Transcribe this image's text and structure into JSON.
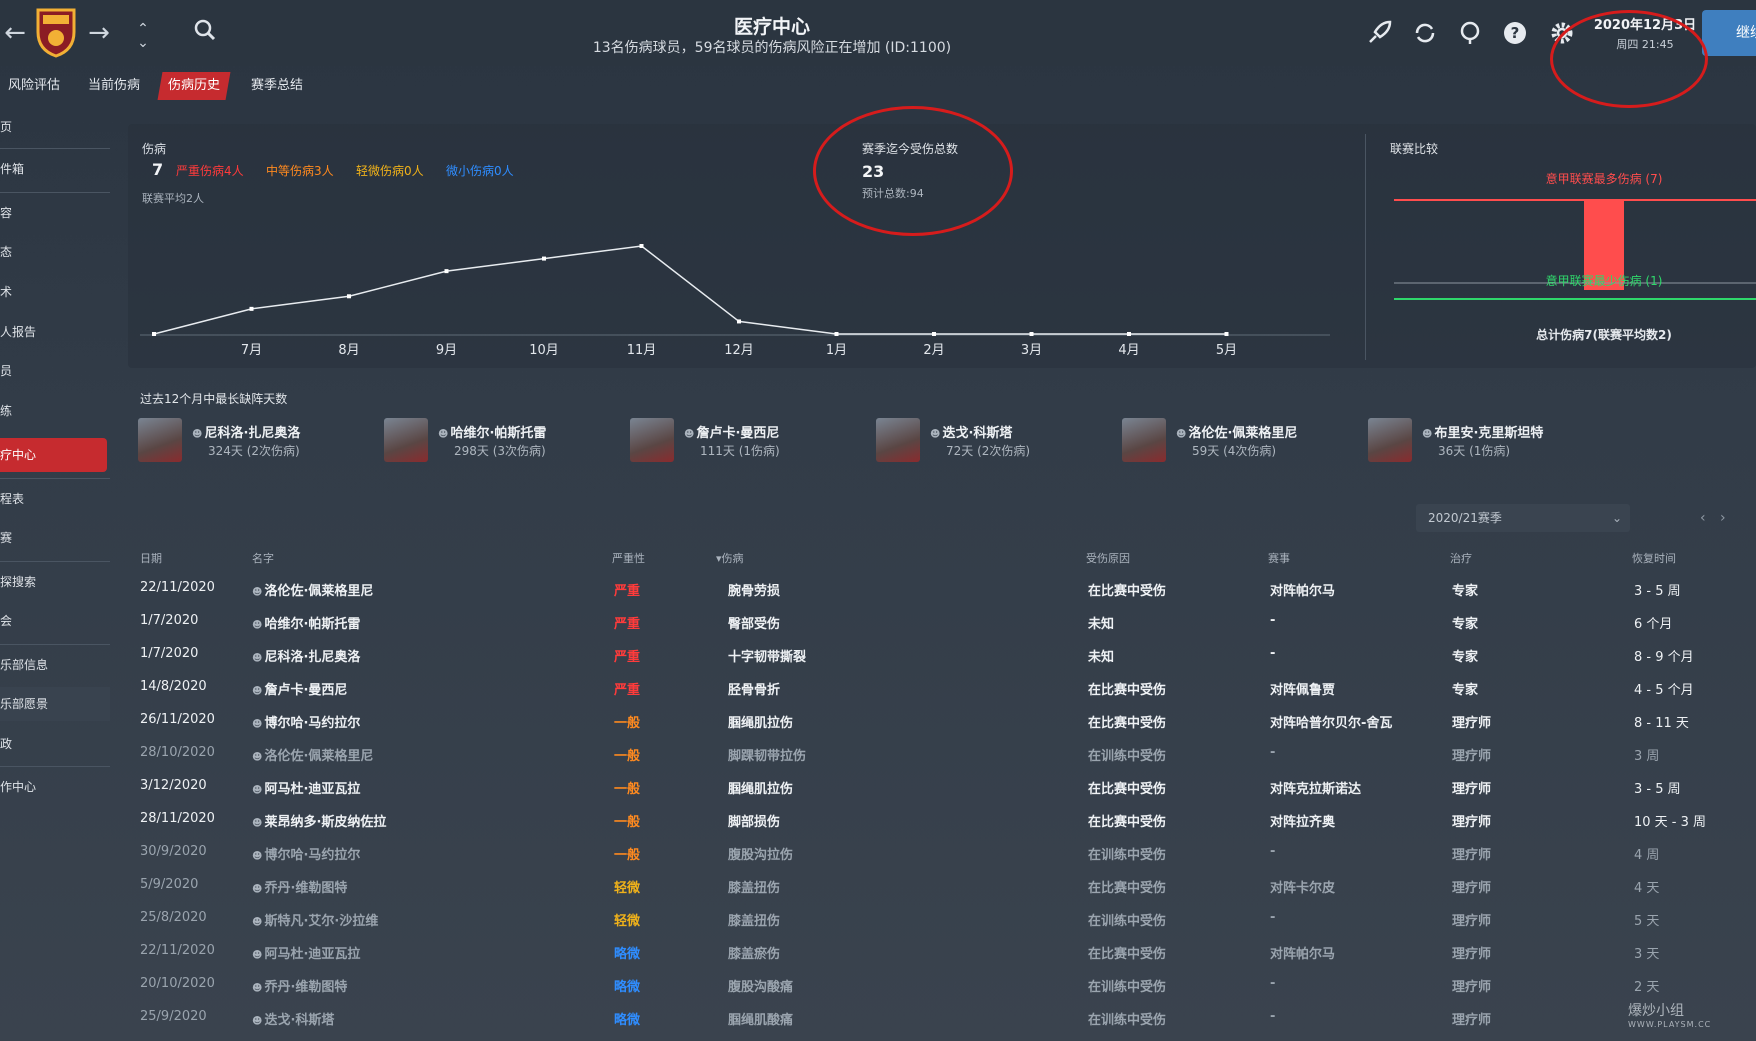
{
  "header": {
    "title": "医疗中心",
    "subtitle": "13名伤病球员，59名球员的伤病风险正在增加 (ID:1100)",
    "date": "2020年12月3日",
    "weekday_time": "周四 21:45",
    "continue_label": "继续"
  },
  "tabs": [
    {
      "label": "风险评估"
    },
    {
      "label": "当前伤病"
    },
    {
      "label": "伤病历史"
    },
    {
      "label": "赛季总结"
    }
  ],
  "sidebar": {
    "items": [
      {
        "label": "页"
      },
      {
        "label": "件箱"
      },
      {
        "label": "容"
      },
      {
        "label": "态"
      },
      {
        "label": "术"
      },
      {
        "label": "人报告"
      },
      {
        "label": "员"
      },
      {
        "label": "练"
      },
      {
        "label": "疗中心"
      },
      {
        "label": "程表"
      },
      {
        "label": "赛"
      },
      {
        "label": "探搜索"
      },
      {
        "label": "会"
      },
      {
        "label": "乐部信息"
      },
      {
        "label": "乐部愿景"
      },
      {
        "label": "政"
      },
      {
        "label": "作中心"
      }
    ]
  },
  "injuries": {
    "label": "伤病",
    "count": "7",
    "serious": "严重伤病4人",
    "medium": "中等伤病3人",
    "light": "轻微伤病0人",
    "minor": "微小伤病0人",
    "league_avg": "联赛平均2人"
  },
  "season_total": {
    "label": "赛季迄今受伤总数",
    "value": "23",
    "projected": "预计总数:94"
  },
  "league_compare": {
    "title": "联赛比较",
    "max_label": "意甲联赛最多伤病 (7)",
    "min_label": "意甲联赛最少伤病 (1)",
    "total_label": "总计伤病7(联赛平均数2)"
  },
  "chart_data": {
    "type": "line",
    "categories": [
      "7月",
      "8月",
      "9月",
      "10月",
      "11月",
      "12月",
      "1月",
      "2月",
      "3月",
      "4月",
      "5月"
    ],
    "series": [
      {
        "values": [
          0,
          2,
          3,
          5,
          6,
          7,
          1,
          0,
          0,
          0,
          0,
          0
        ]
      }
    ],
    "x_points": [
      "",
      "7月",
      "8月",
      "9月",
      "10月",
      "11月",
      "12月",
      "1月",
      "2月",
      "3月",
      "4月",
      "5月"
    ],
    "ylim": [
      0,
      7
    ],
    "grid": false
  },
  "absent": {
    "title": "过去12个月中最长缺阵天数",
    "players": [
      {
        "name": "尼科洛·扎尼奥洛",
        "days": "324天 (2次伤病)"
      },
      {
        "name": "哈维尔·帕斯托雷",
        "days": "298天 (3次伤病)"
      },
      {
        "name": "詹卢卡·曼西尼",
        "days": "111天 (1伤病)"
      },
      {
        "name": "迭戈·科斯塔",
        "days": "72天 (2次伤病)"
      },
      {
        "name": "洛伦佐·佩莱格里尼",
        "days": "59天 (4次伤病)"
      },
      {
        "name": "布里安·克里斯坦特",
        "days": "36天 (1伤病)"
      }
    ]
  },
  "season_select": {
    "value": "2020/21赛季"
  },
  "table": {
    "headers": {
      "date": "日期",
      "name": "名字",
      "severity": "严重性",
      "injury": "▾伤病",
      "cause": "受伤原因",
      "match": "赛事",
      "treatment": "治疗",
      "recovery": "恢复时间"
    },
    "rows": [
      {
        "date": "22/11/2020",
        "name": "洛伦佐·佩莱格里尼",
        "severity": "严重",
        "sev": "serious",
        "injury": "腕骨劳损",
        "cause": "在比赛中受伤",
        "match": "对阵帕尔马",
        "treatment": "专家",
        "recovery": "3 - 5 周",
        "dim": false
      },
      {
        "date": "1/7/2020",
        "name": "哈维尔·帕斯托雷",
        "severity": "严重",
        "sev": "serious",
        "injury": "臀部受伤",
        "cause": "未知",
        "match": "-",
        "treatment": "专家",
        "recovery": "6 个月",
        "dim": false
      },
      {
        "date": "1/7/2020",
        "name": "尼科洛·扎尼奥洛",
        "severity": "严重",
        "sev": "serious",
        "injury": "十字韧带撕裂",
        "cause": "未知",
        "match": "-",
        "treatment": "专家",
        "recovery": "8 - 9 个月",
        "dim": false
      },
      {
        "date": "14/8/2020",
        "name": "詹卢卡·曼西尼",
        "severity": "严重",
        "sev": "serious",
        "injury": "胫骨骨折",
        "cause": "在比赛中受伤",
        "match": "对阵佩鲁贾",
        "treatment": "专家",
        "recovery": "4 - 5 个月",
        "dim": false
      },
      {
        "date": "26/11/2020",
        "name": "博尔哈·马约拉尔",
        "severity": "一般",
        "sev": "medium",
        "injury": "腘绳肌拉伤",
        "cause": "在比赛中受伤",
        "match": "对阵哈普尔贝尔-舍瓦",
        "treatment": "理疗师",
        "recovery": "8 - 11 天",
        "dim": false
      },
      {
        "date": "28/10/2020",
        "name": "洛伦佐·佩莱格里尼",
        "severity": "一般",
        "sev": "medium",
        "injury": "脚踝韧带拉伤",
        "cause": "在训练中受伤",
        "match": "-",
        "treatment": "理疗师",
        "recovery": "3 周",
        "dim": true
      },
      {
        "date": "3/12/2020",
        "name": "阿马杜·迪亚瓦拉",
        "severity": "一般",
        "sev": "medium",
        "injury": "腘绳肌拉伤",
        "cause": "在比赛中受伤",
        "match": "对阵克拉斯诺达",
        "treatment": "理疗师",
        "recovery": "3 - 5 周",
        "dim": false
      },
      {
        "date": "28/11/2020",
        "name": "莱昂纳多·斯皮纳佐拉",
        "severity": "一般",
        "sev": "medium",
        "injury": "脚部损伤",
        "cause": "在比赛中受伤",
        "match": "对阵拉齐奥",
        "treatment": "理疗师",
        "recovery": "10 天 - 3 周",
        "dim": false
      },
      {
        "date": "30/9/2020",
        "name": "博尔哈·马约拉尔",
        "severity": "一般",
        "sev": "medium",
        "injury": "腹股沟拉伤",
        "cause": "在训练中受伤",
        "match": "-",
        "treatment": "理疗师",
        "recovery": "4 周",
        "dim": true
      },
      {
        "date": "5/9/2020",
        "name": "乔丹·维勒图特",
        "severity": "轻微",
        "sev": "light",
        "injury": "膝盖扭伤",
        "cause": "在比赛中受伤",
        "match": "对阵卡尔皮",
        "treatment": "理疗师",
        "recovery": "4 天",
        "dim": true
      },
      {
        "date": "25/8/2020",
        "name": "斯特凡·艾尔·沙拉维",
        "severity": "轻微",
        "sev": "light",
        "injury": "膝盖扭伤",
        "cause": "在训练中受伤",
        "match": "-",
        "treatment": "理疗师",
        "recovery": "5 天",
        "dim": true
      },
      {
        "date": "22/11/2020",
        "name": "阿马杜·迪亚瓦拉",
        "severity": "略微",
        "sev": "minor",
        "injury": "膝盖瘀伤",
        "cause": "在比赛中受伤",
        "match": "对阵帕尔马",
        "treatment": "理疗师",
        "recovery": "3 天",
        "dim": true
      },
      {
        "date": "20/10/2020",
        "name": "乔丹·维勒图特",
        "severity": "略微",
        "sev": "minor",
        "injury": "腹股沟酸痛",
        "cause": "在训练中受伤",
        "match": "-",
        "treatment": "理疗师",
        "recovery": "2 天",
        "dim": true
      },
      {
        "date": "25/9/2020",
        "name": "迭戈·科斯塔",
        "severity": "略微",
        "sev": "minor",
        "injury": "腘绳肌酸痛",
        "cause": "在训练中受伤",
        "match": "-",
        "treatment": "理疗师",
        "recovery": "",
        "dim": true
      }
    ]
  },
  "watermark": {
    "main": "爆炒小组",
    "sub": "WWW.PLAYSM.CC"
  },
  "colors": {
    "accent_red": "#c62b2f",
    "serious": "#ff3b3b",
    "medium": "#ff8a1f",
    "light": "#f0b21a",
    "minor": "#2f8dff",
    "league_min": "#2fd86b"
  }
}
